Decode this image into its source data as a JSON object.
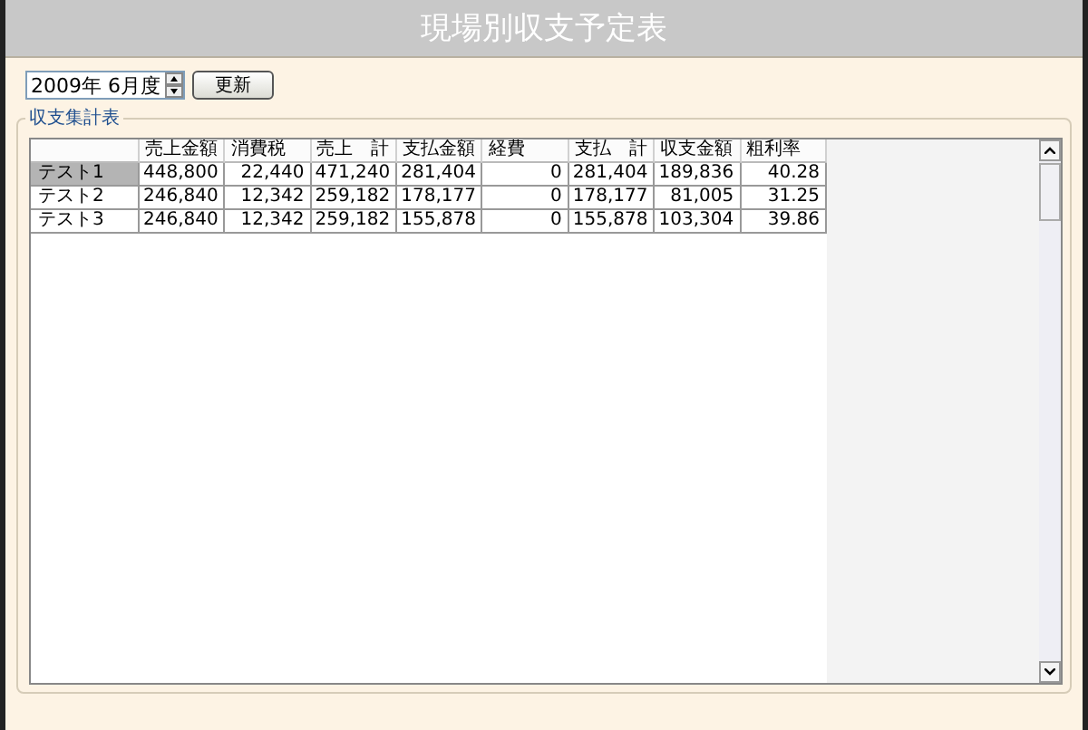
{
  "window": {
    "title": "現場別収支予定表"
  },
  "period": {
    "value": "2009年 6月度",
    "update_button": "更新"
  },
  "group": {
    "label": "収支集計表"
  },
  "table": {
    "columns": [
      "売上金額",
      "消費税",
      "売上　計",
      "支払金額",
      "経費",
      "支払　計",
      "収支金額",
      "粗利率"
    ],
    "rows": [
      {
        "name": "テスト1",
        "selected": true,
        "cells": [
          "448,800",
          "22,440",
          "471,240",
          "281,404",
          "0",
          "281,404",
          "189,836",
          "40.28"
        ]
      },
      {
        "name": "テスト2",
        "selected": false,
        "cells": [
          "246,840",
          "12,342",
          "259,182",
          "178,177",
          "0",
          "178,177",
          "81,005",
          "31.25"
        ]
      },
      {
        "name": "テスト3",
        "selected": false,
        "cells": [
          "246,840",
          "12,342",
          "259,182",
          "155,878",
          "0",
          "155,878",
          "103,304",
          "39.86"
        ]
      }
    ]
  }
}
